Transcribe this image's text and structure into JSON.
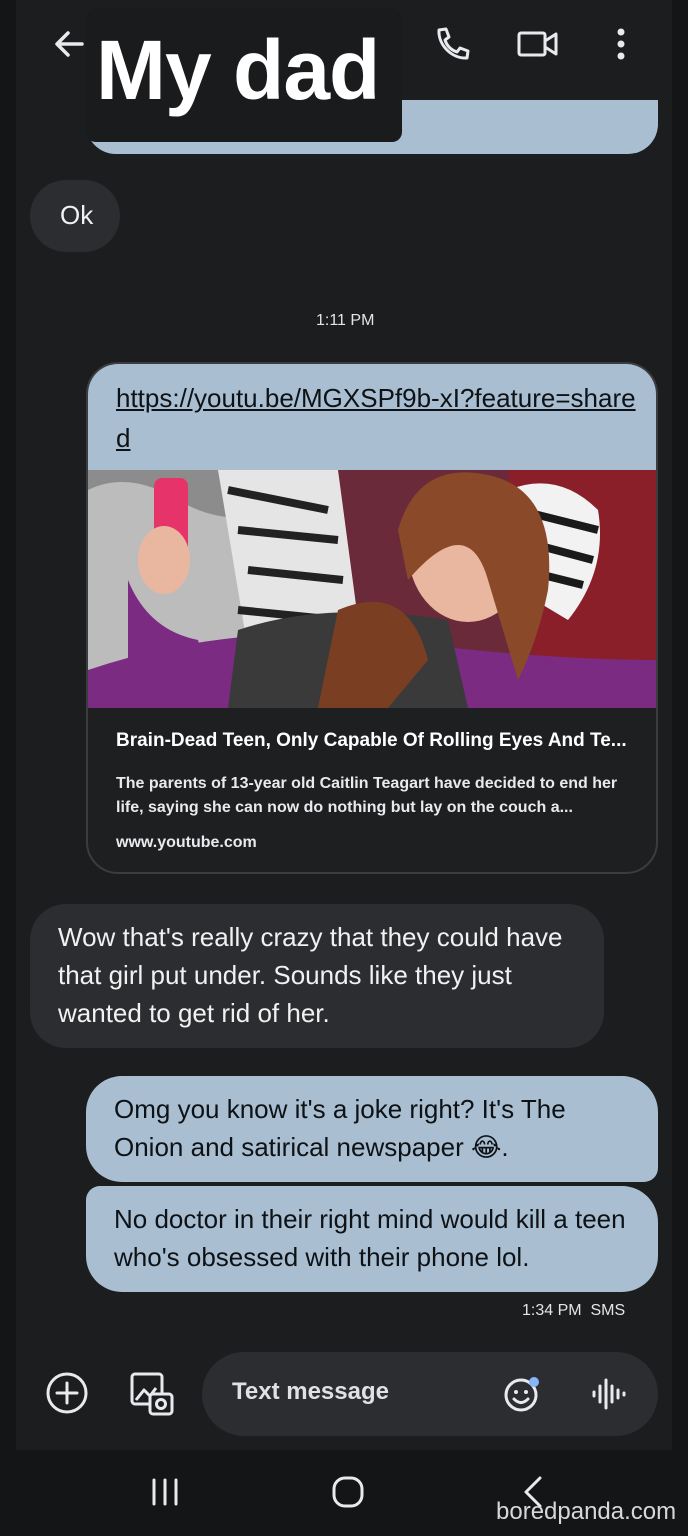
{
  "header": {
    "contact_name": "My dad"
  },
  "messages": [
    {
      "id": "m1",
      "direction": "incoming",
      "text": "Ok"
    },
    {
      "id": "t1",
      "type": "timestamp",
      "text": "1:11 PM"
    },
    {
      "id": "m2",
      "direction": "outgoing",
      "type": "link_preview",
      "url_text": "https://youtu.be/MGXSPf9b-xI?feature=shared",
      "preview_title": "Brain-Dead Teen, Only Capable Of Rolling Eyes And Te...",
      "preview_description": "The parents of 13-year old Caitlin Teagart have decided to end her life, saying she can now do nothing but lay on the couch a...",
      "preview_domain": "www.youtube.com"
    },
    {
      "id": "m3",
      "direction": "incoming",
      "text": "Wow that's really crazy that they could have that girl put under. Sounds like they just wanted to get rid of her."
    },
    {
      "id": "m4",
      "direction": "outgoing",
      "text": "Omg you know it's a joke right? It's The Onion and satirical newspaper 😂."
    },
    {
      "id": "m5",
      "direction": "outgoing",
      "text": "No doctor in their right mind would kill a teen who's obsessed with their phone lol."
    },
    {
      "id": "t2",
      "type": "timestamp",
      "text": "1:34 PM  SMS"
    }
  ],
  "composer": {
    "placeholder": "Text message",
    "icons": [
      "add-icon",
      "gallery-icon",
      "emoji-icon",
      "voice-icon"
    ]
  },
  "navigation": {
    "icons": [
      "recent-apps-icon",
      "home-icon",
      "back-icon"
    ]
  },
  "watermark": "boredpanda.com",
  "colors": {
    "background": "#1c1d1f",
    "incoming_bubble": "#2c2d30",
    "outgoing_bubble": "#a9bfd1"
  }
}
